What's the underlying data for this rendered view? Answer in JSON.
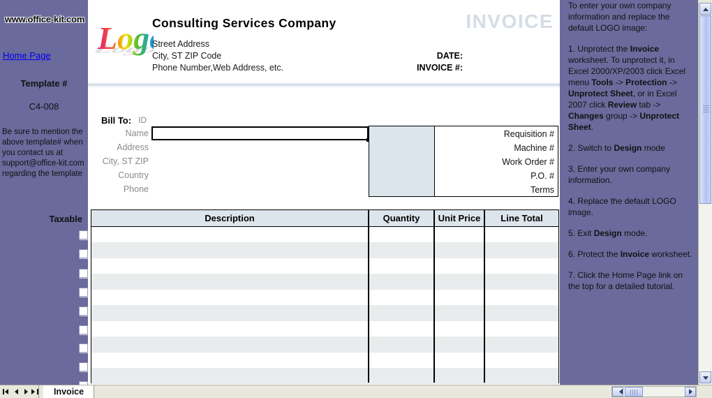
{
  "left_panel": {
    "site_url": "www.office-kit.com",
    "home_link": "Home Page",
    "template_title": "Template #",
    "template_code": "C4-008",
    "note": "Be sure to mention the above template# when you contact us at support@office-kit.com regarding the template",
    "taxable_label": "Taxable",
    "checkbox_count": 9
  },
  "invoice": {
    "logo_alt": "Logo",
    "company_name": "Consulting Services Company",
    "address_lines": [
      "Street Address",
      "City, ST  ZIP Code",
      "Phone Number,Web Address, etc."
    ],
    "title": "INVOICE",
    "date_label": "DATE:",
    "invoice_no_label": "INVOICE #:",
    "bill_to_label": "Bill To:",
    "bill_to_id": "ID",
    "bill_to_fields": [
      "Name",
      "Address",
      "City, ST ZIP",
      "Country",
      "Phone"
    ],
    "ref_fields": [
      "Requisition #",
      "Machine #",
      "Work Order #",
      "P.O. #",
      "Terms"
    ],
    "table": {
      "columns": [
        "Description",
        "Quantity",
        "Unit Price",
        "Line Total"
      ],
      "rows": [
        [],
        [],
        [],
        [],
        [],
        [],
        [],
        [],
        [],
        []
      ]
    }
  },
  "instructions": {
    "intro": "To enter your own company information and replace the default LOGO image:",
    "steps": [
      "1. Unprotect the <b>Invoice</b> worksheet. To unprotect it, in Excel 2000/XP/2003 click Excel menu <b>Tools</b> -&gt; <b>Protection</b> -&gt; <b>Unprotect Sheet</b>, or in Excel 2007 click <b>Review</b> tab -&gt; <b>Changes</b> group -&gt; <b>Unprotect Sheet</b>.",
      "2. Switch to <b>Design</b> mode",
      "3. Enter your own company information.",
      "4. Replace the default LOGO image.",
      "5. Exit <b>Design</b> mode.",
      "6. Protect the <b>Invoice</b> worksheet.",
      "7. Click the Home Page link on the top for a detailed tutorial."
    ]
  },
  "bottom_bar": {
    "sheet_tab": "Invoice",
    "nav_first": "first-sheet",
    "nav_prev": "previous-sheet",
    "nav_next": "next-sheet",
    "nav_last": "last-sheet"
  },
  "colors": {
    "panel_bg": "#6a6a9c",
    "header_fill": "#dde5ec",
    "invoice_word": "#d4dde6",
    "alt_row": "#e9ecec",
    "link": "#0000ee"
  }
}
